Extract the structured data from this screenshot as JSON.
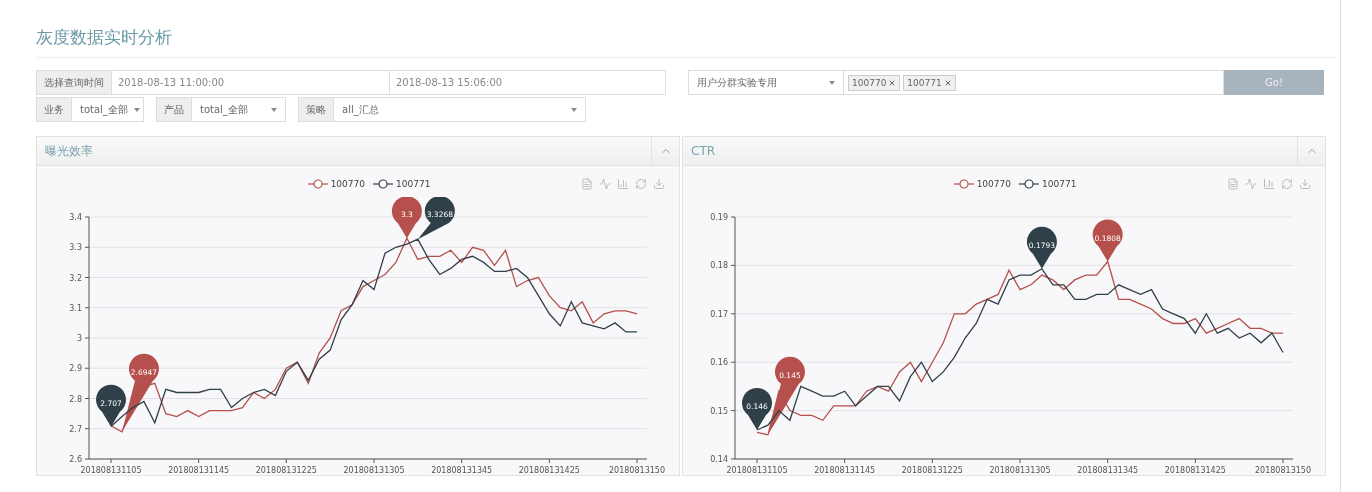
{
  "page": {
    "title": "灰度数据实时分析"
  },
  "filters": {
    "time_label": "选择查询时间",
    "start_time": "2018-08-13 11:00:00",
    "end_time": "2018-08-13 15:06:00",
    "group_select": "用户分群实验专用",
    "tags": [
      {
        "label": "100770"
      },
      {
        "label": "100771"
      }
    ],
    "go_button": "Go!",
    "selects": [
      {
        "label": "业务",
        "value": "total_全部"
      },
      {
        "label": "产品",
        "value": "total_全部"
      },
      {
        "label": "策略",
        "value": "all_汇总"
      }
    ]
  },
  "panels": [
    {
      "title": "曝光效率",
      "chart_data": {
        "type": "line",
        "grid": true,
        "ylim": [
          2.6,
          3.4
        ],
        "yticks": [
          2.6,
          2.7,
          2.8,
          2.9,
          3,
          3.1,
          3.2,
          3.3,
          3.4
        ],
        "categories": [
          "201808131105",
          null,
          null,
          null,
          null,
          null,
          null,
          null,
          "201808131145",
          null,
          null,
          null,
          null,
          null,
          null,
          null,
          "201808131225",
          null,
          null,
          null,
          null,
          null,
          null,
          null,
          "201808131305",
          null,
          null,
          null,
          null,
          null,
          null,
          null,
          "201808131345",
          null,
          null,
          null,
          null,
          null,
          null,
          null,
          "201808131425",
          null,
          null,
          null,
          null,
          null,
          null,
          null,
          "20180813150"
        ],
        "series": [
          {
            "name": "100770",
            "color": "#b5504c",
            "values": [
              2.71,
              2.69,
              2.78,
              2.84,
              2.85,
              2.75,
              2.74,
              2.76,
              2.74,
              2.76,
              2.76,
              2.76,
              2.77,
              2.82,
              2.8,
              2.83,
              2.9,
              2.92,
              2.85,
              2.95,
              3.0,
              3.09,
              3.11,
              3.17,
              3.19,
              3.21,
              3.25,
              3.33,
              3.26,
              3.27,
              3.27,
              3.29,
              3.25,
              3.3,
              3.29,
              3.24,
              3.29,
              3.17,
              3.19,
              3.2,
              3.14,
              3.1,
              3.09,
              3.12,
              3.05,
              3.08,
              3.09,
              3.09,
              3.08
            ]
          },
          {
            "name": "100771",
            "color": "#2f4048",
            "values": [
              2.707,
              2.74,
              2.77,
              2.79,
              2.72,
              2.83,
              2.82,
              2.82,
              2.82,
              2.83,
              2.83,
              2.77,
              2.8,
              2.82,
              2.83,
              2.81,
              2.89,
              2.92,
              2.86,
              2.93,
              2.96,
              3.06,
              3.11,
              3.19,
              3.16,
              3.28,
              3.3,
              3.31,
              3.3268,
              3.26,
              3.21,
              3.23,
              3.26,
              3.27,
              3.25,
              3.22,
              3.22,
              3.23,
              3.2,
              3.14,
              3.08,
              3.04,
              3.12,
              3.05,
              3.04,
              3.03,
              3.05,
              3.02,
              3.02
            ]
          }
        ],
        "annotations": [
          {
            "y": 2.707,
            "text": "2.707"
          },
          "2.6947",
          {
            "y": 3.33,
            "text": "3.3"
          },
          "3.3268"
        ]
      }
    },
    {
      "title": "CTR",
      "chart_data": {
        "type": "line",
        "grid": true,
        "ylim": [
          0.14,
          0.19
        ],
        "yticks": [
          0.14,
          0.15,
          0.16,
          0.17,
          0.18,
          0.19
        ],
        "categories": [
          "201808131105",
          null,
          null,
          null,
          null,
          null,
          null,
          null,
          "201808131145",
          null,
          null,
          null,
          null,
          null,
          null,
          null,
          "201808131225",
          null,
          null,
          null,
          null,
          null,
          null,
          null,
          "201808131305",
          null,
          null,
          null,
          null,
          null,
          null,
          null,
          "201808131345",
          null,
          null,
          null,
          null,
          null,
          null,
          null,
          "201808131425",
          null,
          null,
          null,
          null,
          null,
          null,
          null,
          "20180813150"
        ],
        "series": [
          {
            "name": "100770",
            "color": "#b5504c",
            "values": [
              0.1455,
              0.145,
              0.154,
              0.15,
              0.149,
              0.149,
              0.148,
              0.151,
              0.151,
              0.151,
              0.154,
              0.155,
              0.154,
              0.158,
              0.16,
              0.156,
              0.16,
              0.164,
              0.17,
              0.17,
              0.172,
              0.173,
              0.174,
              0.179,
              0.175,
              0.176,
              0.178,
              0.177,
              0.175,
              0.177,
              0.178,
              0.178,
              0.1808,
              0.173,
              0.173,
              0.172,
              0.171,
              0.169,
              0.168,
              0.168,
              0.169,
              0.166,
              0.167,
              0.168,
              0.169,
              0.167,
              0.167,
              0.166,
              0.166
            ]
          },
          {
            "name": "100771",
            "color": "#2f4048",
            "values": [
              0.146,
              0.147,
              0.15,
              0.148,
              0.155,
              0.154,
              0.153,
              0.153,
              0.154,
              0.151,
              0.153,
              0.155,
              0.155,
              0.152,
              0.157,
              0.16,
              0.156,
              0.158,
              0.161,
              0.165,
              0.168,
              0.173,
              0.172,
              0.177,
              0.178,
              0.178,
              0.1793,
              0.176,
              0.176,
              0.173,
              0.173,
              0.174,
              0.174,
              0.176,
              0.175,
              0.174,
              0.175,
              0.171,
              0.17,
              0.169,
              0.166,
              0.17,
              0.166,
              0.167,
              0.165,
              0.166,
              0.164,
              0.166,
              0.162
            ]
          }
        ],
        "annotations": [
          {
            "y": 0.146,
            "text": "0.146"
          },
          "0.145",
          {
            "y": 0.1793,
            "text": "0.1793"
          },
          {
            "y": 0.1808,
            "text": "0.1808"
          }
        ]
      }
    }
  ]
}
